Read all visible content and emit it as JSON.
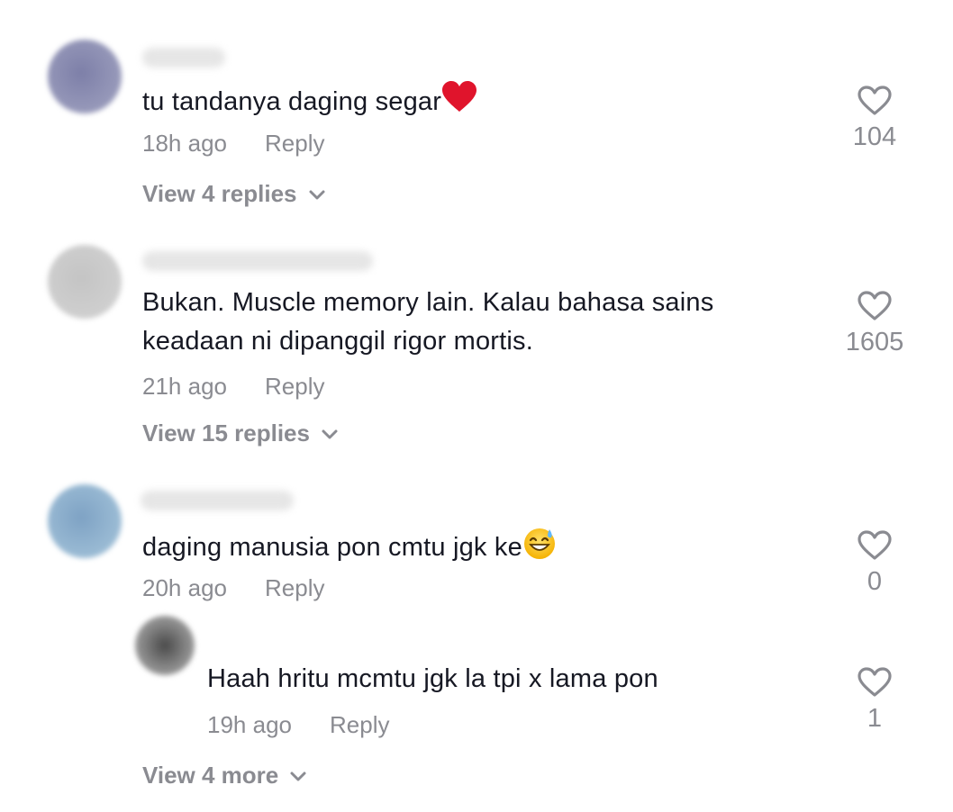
{
  "comments": [
    {
      "text": "tu tandanya daging segar",
      "emoji": "red-heart",
      "time": "18h ago",
      "reply_label": "Reply",
      "likes": "104",
      "view_replies": "View 4 replies",
      "avatar_color": "#8a8aa8"
    },
    {
      "text_line1": "Bukan. Muscle memory lain. Kalau bahasa sains",
      "text_line2": "keadaan ni dipanggil rigor mortis.",
      "time": "21h ago",
      "reply_label": "Reply",
      "likes": "1605",
      "view_replies": "View 15 replies",
      "avatar_color": "#c8c8c8"
    },
    {
      "text": "daging manusia pon cmtu jgk ke",
      "emoji": "grinning-sweat-face",
      "time": "20h ago",
      "reply_label": "Reply",
      "likes": "0",
      "avatar_color": "#8fb0cc",
      "reply": {
        "text": "Haah hritu mcmtu jgk la tpi x lama pon",
        "time": "19h ago",
        "reply_label": "Reply",
        "likes": "1",
        "avatar_color": "#555555"
      },
      "view_more": "View 4 more"
    }
  ]
}
